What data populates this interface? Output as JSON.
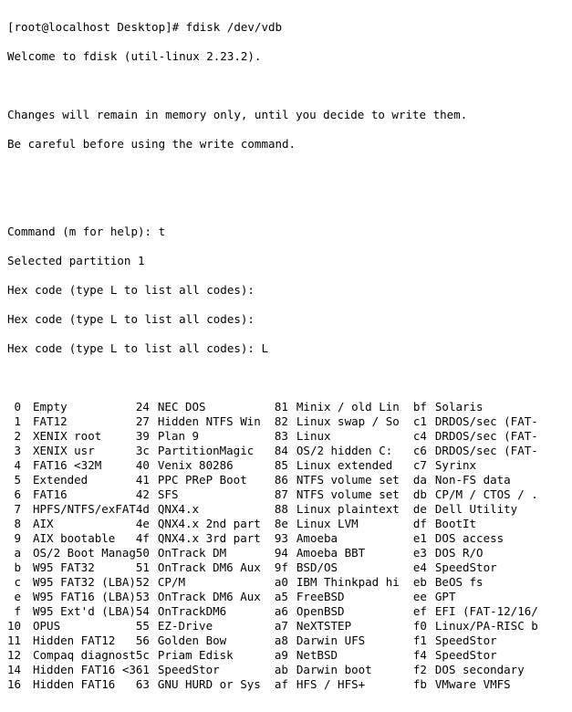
{
  "prompt": "[root@localhost Desktop]# ",
  "cmd": "fdisk /dev/vdb",
  "lines": {
    "welcome": "Welcome to fdisk (util-linux 2.23.2).",
    "changes": "Changes will remain in memory only, until you decide to write them.",
    "careful": "Be careful before using the write command.",
    "cmdhelp": "Command (m for help): t",
    "selected": "Selected partition 1",
    "hex1": "Hex code (type L to list all codes):",
    "hex2": "Hex code (type L to list all codes):",
    "hex3": "Hex code (type L to list all codes): L"
  },
  "codes": [
    {
      "c0": " 0",
      "n0": "Empty",
      "c1": "24",
      "n1": "NEC DOS",
      "c2": "81",
      "n2": "Minix / old Lin",
      "c3": "bf",
      "n3": "Solaris"
    },
    {
      "c0": " 1",
      "n0": "FAT12",
      "c1": "27",
      "n1": "Hidden NTFS Win",
      "c2": "82",
      "n2": "Linux swap / So",
      "c3": "c1",
      "n3": "DRDOS/sec (FAT-"
    },
    {
      "c0": " 2",
      "n0": "XENIX root",
      "c1": "39",
      "n1": "Plan 9",
      "c2": "83",
      "n2": "Linux",
      "c3": "c4",
      "n3": "DRDOS/sec (FAT-"
    },
    {
      "c0": " 3",
      "n0": "XENIX usr",
      "c1": "3c",
      "n1": "PartitionMagic",
      "c2": "84",
      "n2": "OS/2 hidden C:",
      "c3": "c6",
      "n3": "DRDOS/sec (FAT-"
    },
    {
      "c0": " 4",
      "n0": "FAT16 <32M",
      "c1": "40",
      "n1": "Venix 80286",
      "c2": "85",
      "n2": "Linux extended",
      "c3": "c7",
      "n3": "Syrinx"
    },
    {
      "c0": " 5",
      "n0": "Extended",
      "c1": "41",
      "n1": "PPC PReP Boot",
      "c2": "86",
      "n2": "NTFS volume set",
      "c3": "da",
      "n3": "Non-FS data"
    },
    {
      "c0": " 6",
      "n0": "FAT16",
      "c1": "42",
      "n1": "SFS",
      "c2": "87",
      "n2": "NTFS volume set",
      "c3": "db",
      "n3": "CP/M / CTOS / ."
    },
    {
      "c0": " 7",
      "n0": "HPFS/NTFS/exFAT",
      "c1": "4d",
      "n1": "QNX4.x",
      "c2": "88",
      "n2": "Linux plaintext",
      "c3": "de",
      "n3": "Dell Utility"
    },
    {
      "c0": " 8",
      "n0": "AIX",
      "c1": "4e",
      "n1": "QNX4.x 2nd part",
      "c2": "8e",
      "n2": "Linux LVM",
      "c3": "df",
      "n3": "BootIt"
    },
    {
      "c0": " 9",
      "n0": "AIX bootable",
      "c1": "4f",
      "n1": "QNX4.x 3rd part",
      "c2": "93",
      "n2": "Amoeba",
      "c3": "e1",
      "n3": "DOS access"
    },
    {
      "c0": " a",
      "n0": "OS/2 Boot Manag",
      "c1": "50",
      "n1": "OnTrack DM",
      "c2": "94",
      "n2": "Amoeba BBT",
      "c3": "e3",
      "n3": "DOS R/O"
    },
    {
      "c0": " b",
      "n0": "W95 FAT32",
      "c1": "51",
      "n1": "OnTrack DM6 Aux",
      "c2": "9f",
      "n2": "BSD/OS",
      "c3": "e4",
      "n3": "SpeedStor"
    },
    {
      "c0": " c",
      "n0": "W95 FAT32 (LBA)",
      "c1": "52",
      "n1": "CP/M",
      "c2": "a0",
      "n2": "IBM Thinkpad hi",
      "c3": "eb",
      "n3": "BeOS fs"
    },
    {
      "c0": " e",
      "n0": "W95 FAT16 (LBA)",
      "c1": "53",
      "n1": "OnTrack DM6 Aux",
      "c2": "a5",
      "n2": "FreeBSD",
      "c3": "ee",
      "n3": "GPT"
    },
    {
      "c0": " f",
      "n0": "W95 Ext'd (LBA)",
      "c1": "54",
      "n1": "OnTrackDM6",
      "c2": "a6",
      "n2": "OpenBSD",
      "c3": "ef",
      "n3": "EFI (FAT-12/16/"
    },
    {
      "c0": "10",
      "n0": "OPUS",
      "c1": "55",
      "n1": "EZ-Drive",
      "c2": "a7",
      "n2": "NeXTSTEP",
      "c3": "f0",
      "n3": "Linux/PA-RISC b"
    },
    {
      "c0": "11",
      "n0": "Hidden FAT12",
      "c1": "56",
      "n1": "Golden Bow",
      "c2": "a8",
      "n2": "Darwin UFS",
      "c3": "f1",
      "n3": "SpeedStor"
    },
    {
      "c0": "12",
      "n0": "Compaq diagnost",
      "c1": "5c",
      "n1": "Priam Edisk",
      "c2": "a9",
      "n2": "NetBSD",
      "c3": "f4",
      "n3": "SpeedStor"
    },
    {
      "c0": "14",
      "n0": "Hidden FAT16 <3",
      "c1": "61",
      "n1": "SpeedStor",
      "c2": "ab",
      "n2": "Darwin boot",
      "c3": "f2",
      "n3": "DOS secondary"
    },
    {
      "c0": "16",
      "n0": "Hidden FAT16",
      "c1": "63",
      "n1": "GNU HURD or Sys",
      "c2": "af",
      "n2": "HFS / HFS+",
      "c3": "fb",
      "n3": "VMware VMFS"
    }
  ]
}
